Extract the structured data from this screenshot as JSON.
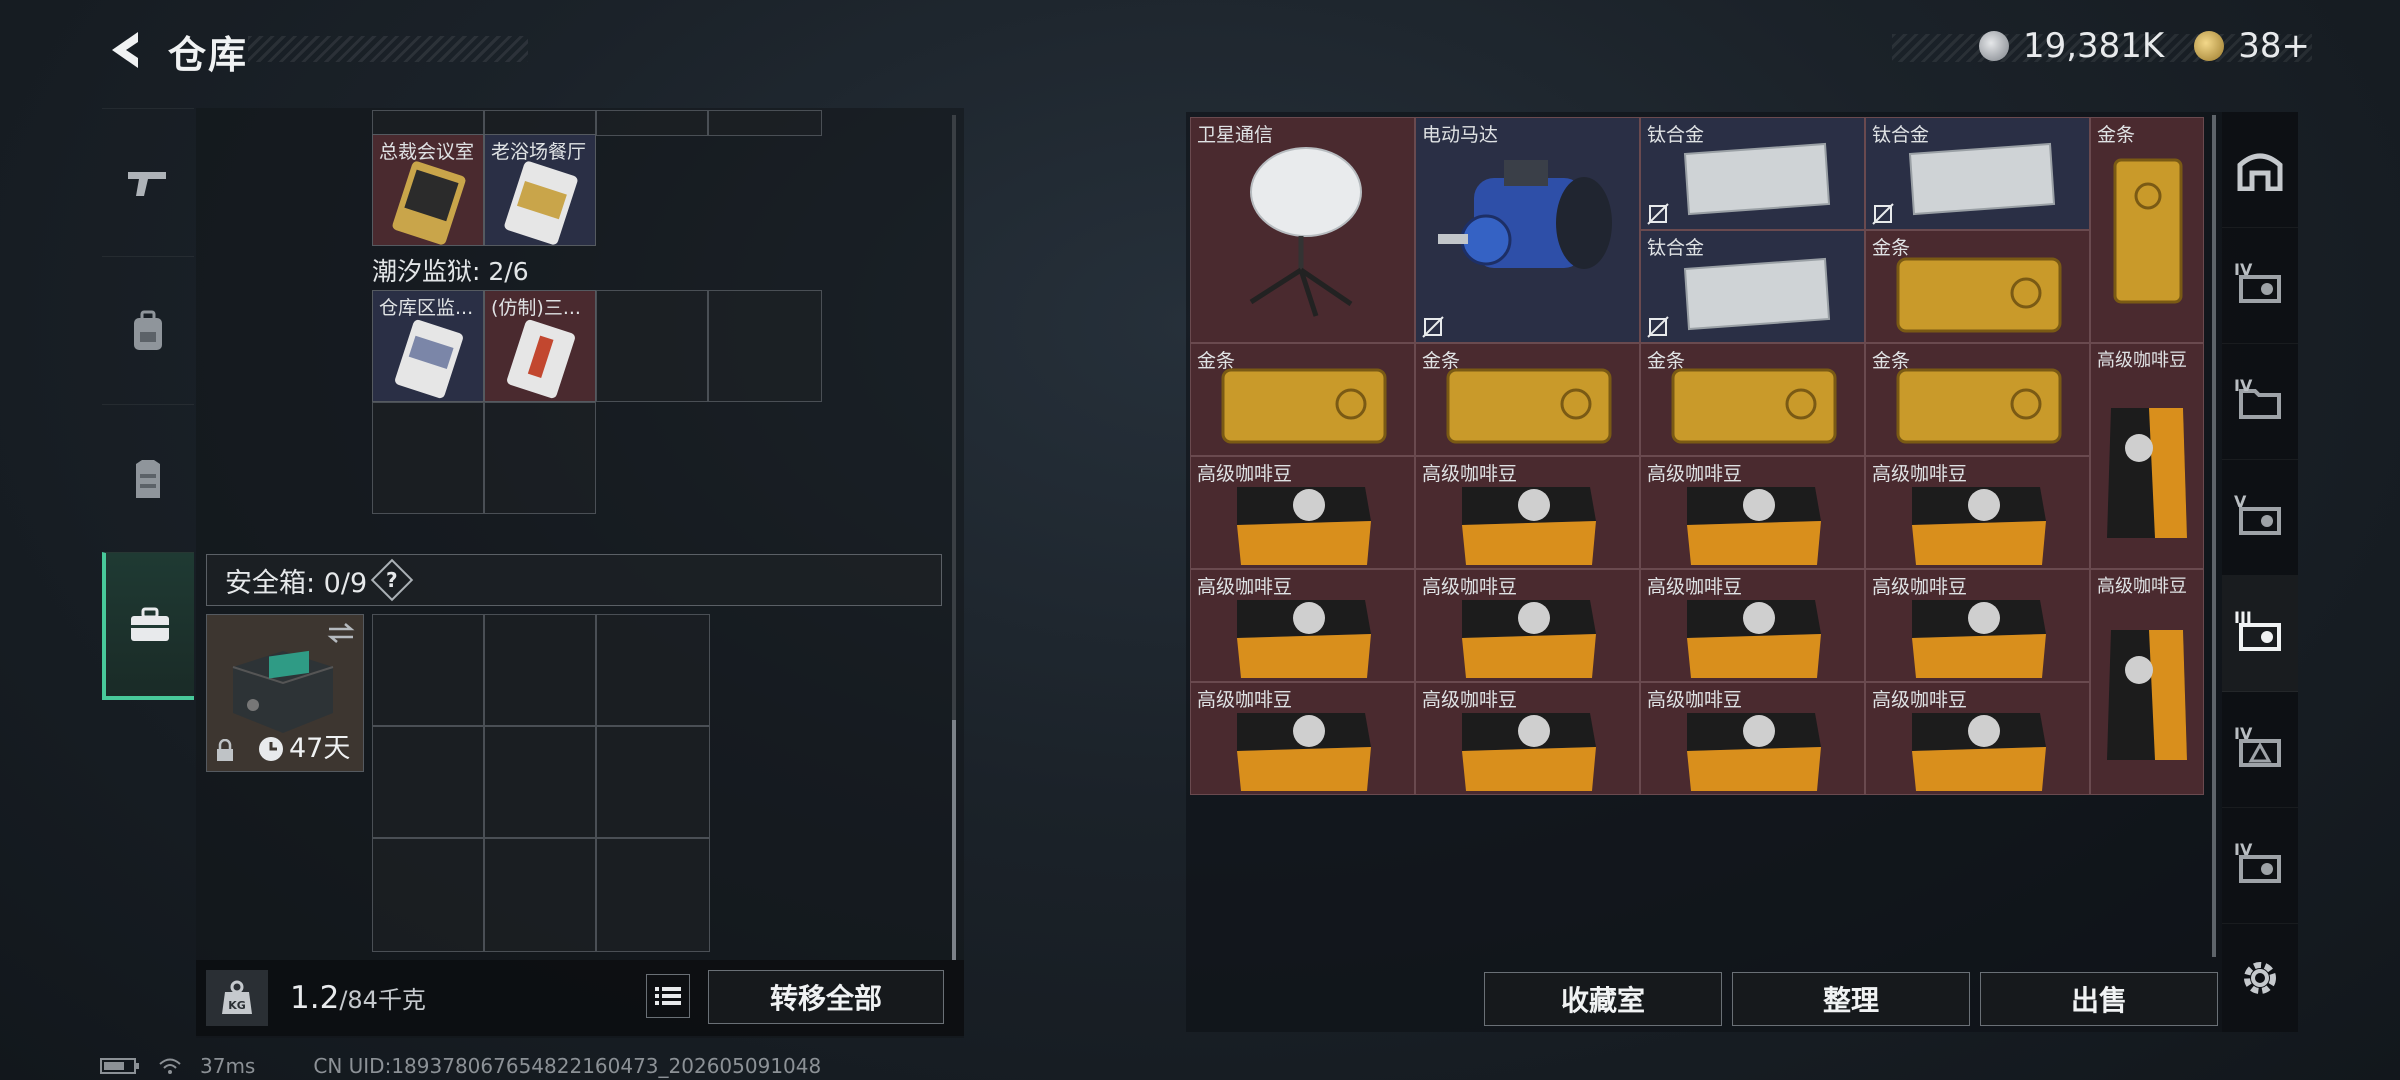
{
  "header": {
    "title": "仓库"
  },
  "currency": {
    "silver_amount": "19,381K",
    "gold_amount": "38+"
  },
  "left_rail": {
    "items": [
      "gun-icon",
      "backpack-icon",
      "vest-icon",
      "safebox-icon"
    ],
    "active_index": 3
  },
  "cards_section": {
    "top_tiles": [
      "总裁会议室",
      "老浴场餐厅"
    ],
    "prison_label": "潮汐监狱: 2/6",
    "prison_tiles": [
      "仓库区监...",
      "(仿制)三..."
    ]
  },
  "safebox": {
    "label": "安全箱: 0/9",
    "help": "?",
    "duration": "47天"
  },
  "bottom_left": {
    "weight_value": "1.2",
    "weight_capacity": "/84千克",
    "transfer_all_label": "转移全部"
  },
  "storage": {
    "items": [
      {
        "label": "卫星通信",
        "kind": "satellite"
      },
      {
        "label": "电动马达",
        "kind": "motor"
      },
      {
        "label": "钛合金",
        "kind": "titanium"
      },
      {
        "label": "钛合金",
        "kind": "titanium"
      },
      {
        "label": "金条",
        "kind": "goldbar"
      },
      {
        "label": "钛合金",
        "kind": "titanium"
      },
      {
        "label": "金条",
        "kind": "goldbar"
      },
      {
        "label": "金条",
        "kind": "goldbar"
      },
      {
        "label": "金条",
        "kind": "goldbar"
      },
      {
        "label": "金条",
        "kind": "goldbar"
      },
      {
        "label": "金条",
        "kind": "goldbar"
      },
      {
        "label": "高级咖啡豆",
        "kind": "coffee"
      }
    ],
    "coffee_label": "高级咖啡豆"
  },
  "right_rail": {
    "tiers": [
      "",
      "IV",
      "IV",
      "V",
      "III",
      "IV",
      "IV"
    ],
    "active_index": 4
  },
  "actions": {
    "collection": "收藏室",
    "organize": "整理",
    "sell": "出售"
  },
  "status": {
    "ping": "37ms",
    "uid": "CN UID:1893780676548221604​73_202605091048"
  },
  "colors": {
    "accent_green": "#48c99a",
    "item_bg_red": "#4a2a2f",
    "item_bg_blue": "#2a2f45"
  }
}
